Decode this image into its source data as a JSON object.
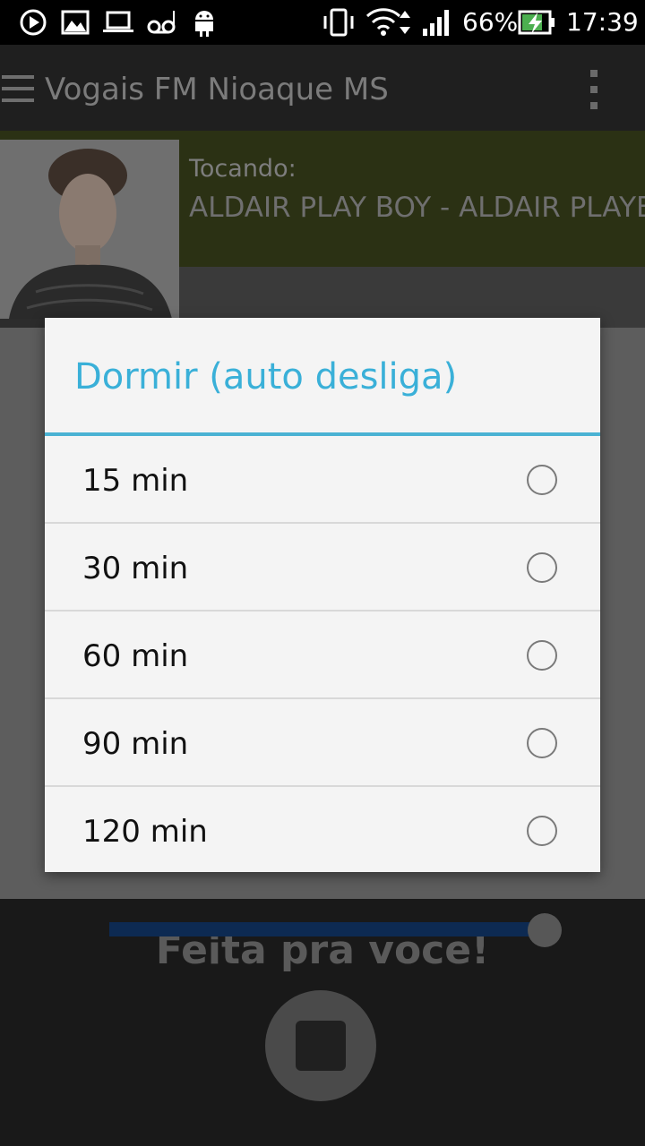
{
  "status_bar": {
    "battery": "66%",
    "time": "17:39",
    "icons": [
      "play-circle-icon",
      "image-icon",
      "laptop-icon",
      "voicemail-icon",
      "android-icon",
      "vibrate-icon",
      "wifi-icon",
      "signal-icon",
      "battery-charging-icon"
    ]
  },
  "app_bar": {
    "title": "Vogais FM Nioaque MS",
    "menu_icon": "menu-icon",
    "overflow_icon": "overflow-menu-icon"
  },
  "now_playing": {
    "label": "Tocando:",
    "song": "ALDAIR PLAY BOY - ALDAIR PLAYBOY"
  },
  "player": {
    "slogan": "Feita pra voce!",
    "volume_level": 0.94,
    "colors": {
      "seek_track": "#0d2a52"
    }
  },
  "dialog": {
    "title": "Dormir (auto desliga)",
    "accent": "#3ab0d8",
    "options": [
      {
        "label": "15 min",
        "selected": false
      },
      {
        "label": "30 min",
        "selected": false
      },
      {
        "label": "60 min",
        "selected": false
      },
      {
        "label": "90 min",
        "selected": false
      },
      {
        "label": "120 min",
        "selected": false
      }
    ]
  }
}
